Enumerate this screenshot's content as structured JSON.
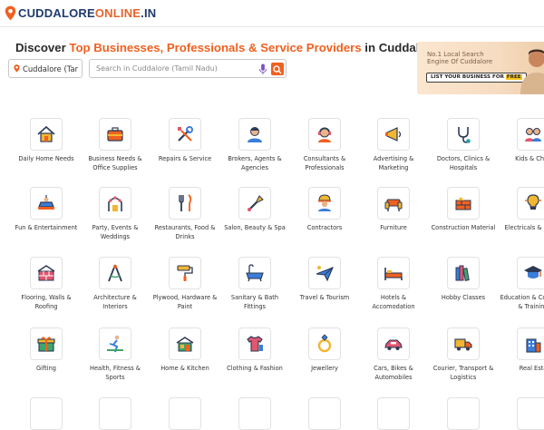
{
  "header": {
    "logo_main": "CUDDALORE",
    "logo_accent": "ONLINE",
    "logo_tld": ".IN"
  },
  "hero": {
    "headline_pre": "Discover ",
    "headline_highlight": "Top Businesses, Professionals & Service Providers",
    "headline_post": " in Cuddalore city!",
    "location_value": "Cuddalore (Tar",
    "search_placeholder": "Search in Cuddalore (Tamil Nadu)"
  },
  "promo": {
    "title": "No.1 Local Search Engine Of Cuddalore",
    "button_pre": "LIST YOUR BUSINESS FOR ",
    "button_free": "FREE"
  },
  "colors": {
    "brand_orange": "#f0601f",
    "brand_navy": "#1f3b6e"
  },
  "categories": [
    {
      "label": "Daily Home Needs",
      "icon": "home-icon"
    },
    {
      "label": "Business Needs & Office Supplies",
      "icon": "briefcase-icon"
    },
    {
      "label": "Repairs & Service",
      "icon": "tools-icon"
    },
    {
      "label": "Brokers, Agents & Agencies",
      "icon": "agent-icon"
    },
    {
      "label": "Consultants & Professionals",
      "icon": "consultant-icon"
    },
    {
      "label": "Advertising & Marketing",
      "icon": "megaphone-icon"
    },
    {
      "label": "Doctors, Clinics & Hospitals",
      "icon": "stethoscope-icon"
    },
    {
      "label": "Kids & Child",
      "icon": "kids-icon"
    },
    {
      "label": "Fun & Entertainment",
      "icon": "bumper-car-icon"
    },
    {
      "label": "Party, Events & Weddings",
      "icon": "wedding-arch-icon"
    },
    {
      "label": "Restaurants, Food & Drinks",
      "icon": "cutlery-icon"
    },
    {
      "label": "Salon, Beauty & Spa",
      "icon": "brush-icon"
    },
    {
      "label": "Contractors",
      "icon": "worker-icon"
    },
    {
      "label": "Furniture",
      "icon": "sofa-icon"
    },
    {
      "label": "Construction Material",
      "icon": "bricks-icon"
    },
    {
      "label": "Electricals & Lights",
      "icon": "bulb-icon"
    },
    {
      "label": "Flooring, Walls & Roofing",
      "icon": "wall-icon"
    },
    {
      "label": "Architecture & Interiors",
      "icon": "compass-icon"
    },
    {
      "label": "Plywood, Hardware & Paint",
      "icon": "paint-roller-icon"
    },
    {
      "label": "Sanitary & Bath Fittings",
      "icon": "bathtub-icon"
    },
    {
      "label": "Travel & Tourism",
      "icon": "plane-icon"
    },
    {
      "label": "Hotels & Accomodation",
      "icon": "bed-icon"
    },
    {
      "label": "Hobby Classes",
      "icon": "books-icon"
    },
    {
      "label": "Education & Coaching & Training",
      "icon": "education-icon"
    },
    {
      "label": "Gifting",
      "icon": "gift-icon"
    },
    {
      "label": "Health, Fitness & Sports",
      "icon": "fitness-icon"
    },
    {
      "label": "Home & Kitchen",
      "icon": "kitchen-icon"
    },
    {
      "label": "Clothing & Fashion",
      "icon": "clothing-icon"
    },
    {
      "label": "Jewellery",
      "icon": "ring-icon"
    },
    {
      "label": "Cars, Bikes & Automobiles",
      "icon": "car-icon"
    },
    {
      "label": "Courier, Transport & Logistics",
      "icon": "truck-icon"
    },
    {
      "label": "Real Esta",
      "icon": "building-icon"
    }
  ]
}
